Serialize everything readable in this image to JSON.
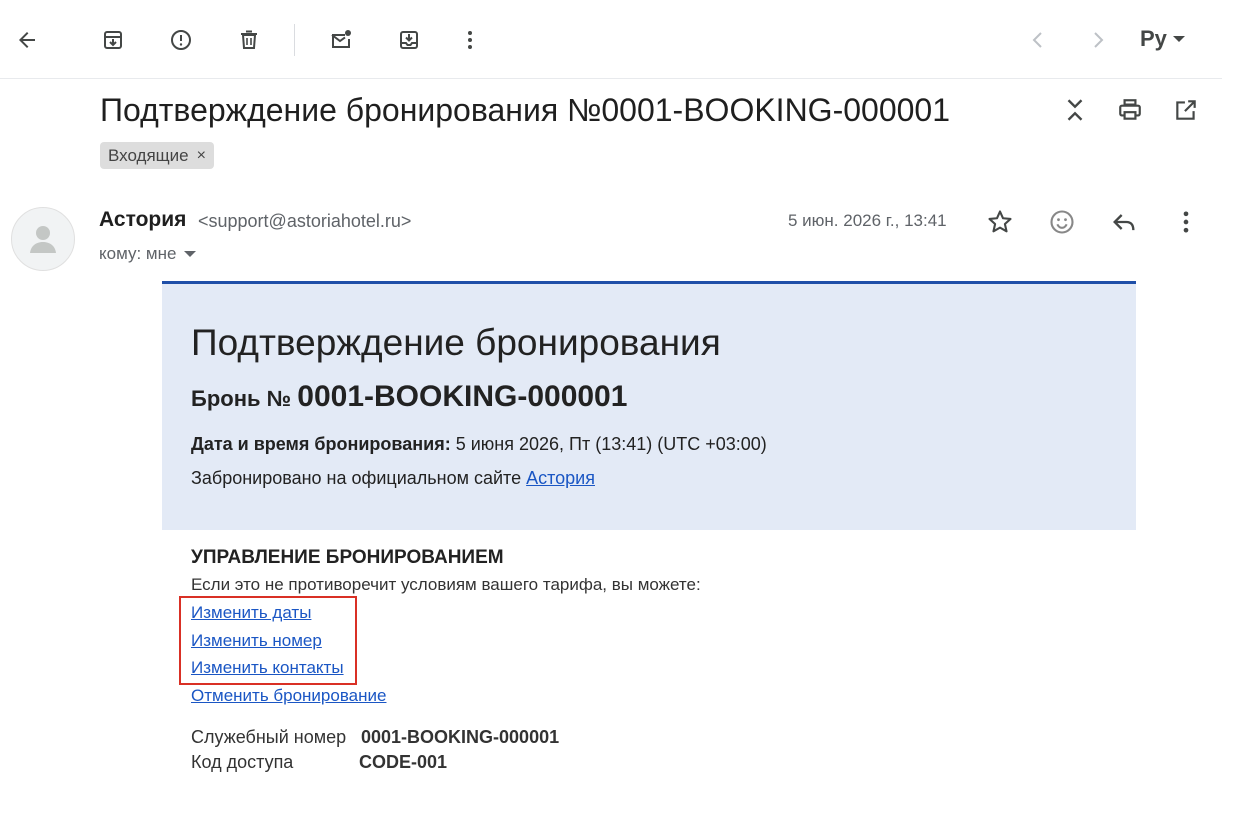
{
  "toolbar": {
    "language": "Ру",
    "icons": [
      "back-arrow-icon",
      "archive-icon",
      "report-spam-icon",
      "delete-icon",
      "mark-unread-icon",
      "move-to-icon",
      "more-vert-icon",
      "prev-icon",
      "next-icon"
    ]
  },
  "message": {
    "subject": "Подтверждение бронирования №0001-BOOKING-000001",
    "label": "Входящие",
    "label_remove": "×",
    "sender_name": "Астория",
    "sender_email": "<support@astoriahotel.ru>",
    "to": "кому: мне",
    "date": "5 июн. 2026 г., 13:41"
  },
  "email": {
    "title": "Подтверждение бронирования",
    "booking_prefix": "Бронь №",
    "booking_number": "0001-BOOKING-000001",
    "datetime_label": "Дата и время бронирования:",
    "datetime_value": "5 июня 2026, Пт (13:41) (UTC +03:00)",
    "site_text": "Забронировано на официальном сайте",
    "site_link": "Астория",
    "management_title": "УПРАВЛЕНИЕ БРОНИРОВАНИЕМ",
    "management_desc": "Если это не противоречит условиям вашего тарифа, вы можете:",
    "links": [
      "Изменить даты",
      "Изменить номер",
      "Изменить контакты",
      "Отменить бронирование"
    ],
    "service_label": "Служебный номер",
    "service_value": "0001-BOOKING-000001",
    "access_label": "Код доступа",
    "access_value": "CODE-001"
  },
  "colors": {
    "banner_bg": "#e3eaf6",
    "banner_border": "#1f4fa8",
    "link": "#1a56c4",
    "highlight": "#d93025"
  }
}
